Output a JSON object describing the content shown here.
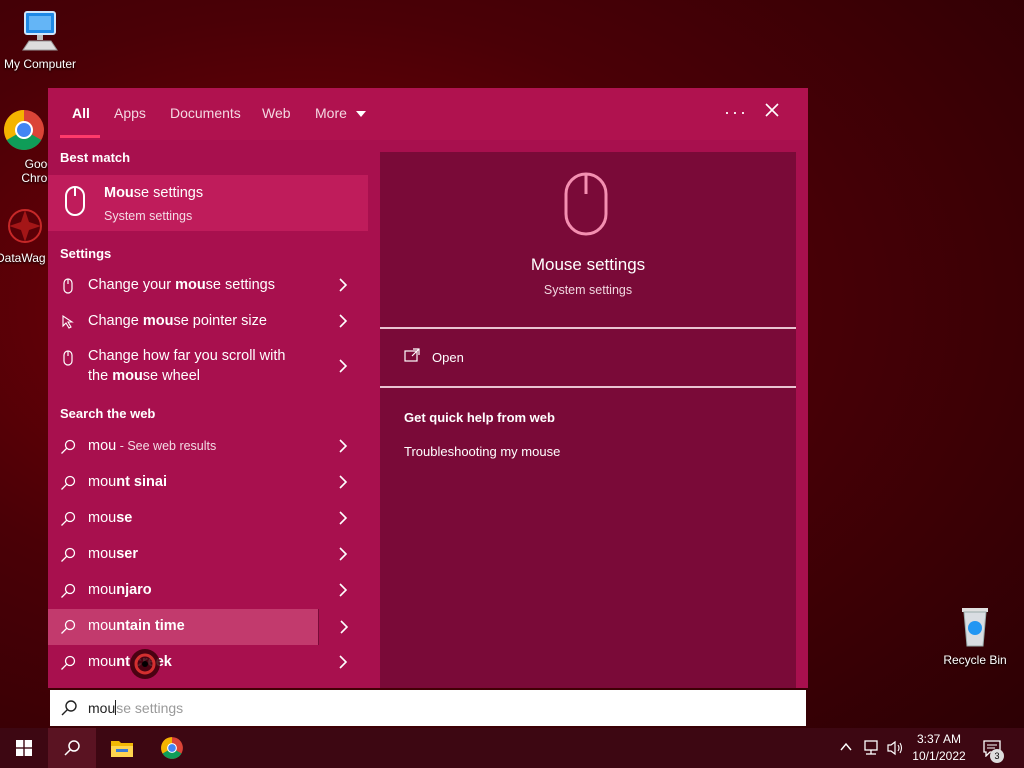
{
  "desktop": {
    "icons": [
      {
        "label": "My Computer"
      },
      {
        "label": "Goog\nChron"
      },
      {
        "label": "DataWag"
      },
      {
        "label": "Recycle Bin"
      }
    ]
  },
  "search_panel": {
    "tabs": {
      "all": "All",
      "apps": "Apps",
      "documents": "Documents",
      "web": "Web",
      "more": "More"
    },
    "best_match": {
      "heading": "Best match",
      "title_bold": "Mou",
      "title_rest": "se settings",
      "subtitle": "System settings"
    },
    "settings": {
      "heading": "Settings",
      "items": [
        {
          "pre": "Change your ",
          "bold": "mou",
          "post": "se settings"
        },
        {
          "pre": "Change ",
          "bold": "mou",
          "post": "se pointer size"
        },
        {
          "pre": "Change how far you scroll with the ",
          "bold": "mou",
          "post": "se wheel"
        }
      ]
    },
    "web": {
      "heading": "Search the web",
      "items": [
        {
          "pre": "mou",
          "bold": "",
          "post": " - See web results"
        },
        {
          "pre": "mou",
          "bold": "nt sinai",
          "post": ""
        },
        {
          "pre": "mou",
          "bold": "se",
          "post": ""
        },
        {
          "pre": "mou",
          "bold": "ser",
          "post": ""
        },
        {
          "pre": "mou",
          "bold": "njaro",
          "post": ""
        },
        {
          "pre": "mou",
          "bold": "ntain time",
          "post": ""
        },
        {
          "pre": "mou",
          "bold": "nt creek",
          "post": ""
        }
      ]
    },
    "preview": {
      "title": "Mouse settings",
      "subtitle": "System settings",
      "open_label": "Open",
      "quick_help_heading": "Get quick help from web",
      "quick_help_link": "Troubleshooting my mouse"
    },
    "search_box": {
      "typed": "mou",
      "suggestion": "se settings"
    }
  },
  "taskbar": {
    "time": "3:37 AM",
    "date": "10/1/2022",
    "notification_count": "3"
  },
  "colors": {
    "accent": "#a8104e",
    "preview_bg": "#7a0a38",
    "taskbar": "#3d0712"
  }
}
